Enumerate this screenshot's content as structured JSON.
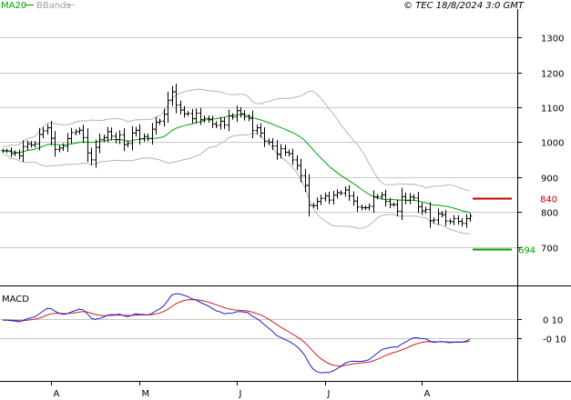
{
  "header": {
    "legend_ma": "MA20",
    "legend_bb": "BBands",
    "copyright": "© TEC 18/8/2024 3:0 GMT"
  },
  "colors": {
    "background": "#ffffff",
    "grid": "#c8c8c8",
    "axis": "#000000",
    "price_bar": "#000000",
    "ma20": "#00a000",
    "bbands": "#b4b4b4",
    "macd_line": "#2020c8",
    "signal_line": "#c82020",
    "resistance": "#c00000",
    "support": "#00a000",
    "legend_bb_text": "#a0a0a0"
  },
  "chart_data": [
    {
      "type": "ohlc",
      "panel": "price",
      "y_ticks": [
        1300,
        1200,
        1100,
        1000,
        900,
        800,
        700
      ],
      "y_tick_labels": [
        "1300",
        "1200",
        "1100",
        "1000",
        "900",
        "800",
        "700"
      ],
      "ylim": [
        592,
        1355
      ],
      "grid": true,
      "x_ticks": [
        {
          "index": 12,
          "label": "A"
        },
        {
          "index": 34,
          "label": "M"
        },
        {
          "index": 58,
          "label": "J"
        },
        {
          "index": 80,
          "label": "J"
        },
        {
          "index": 104,
          "label": "A"
        }
      ],
      "x_count": 117,
      "closes": [
        975,
        975,
        967,
        969,
        961,
        987,
        995,
        992,
        995,
        1022,
        1032,
        1041,
        1011,
        979,
        983,
        988,
        1010,
        1027,
        1030,
        1034,
        1013,
        969,
        949,
        985,
        1008,
        1013,
        1030,
        1017,
        1007,
        1021,
        993,
        996,
        1026,
        1034,
        1010,
        1016,
        1011,
        1037,
        1057,
        1060,
        1080,
        1120,
        1144,
        1106,
        1092,
        1081,
        1082,
        1067,
        1083,
        1064,
        1068,
        1064,
        1052,
        1048,
        1060,
        1049,
        1075,
        1072,
        1090,
        1081,
        1072,
        1068,
        1033,
        1041,
        1026,
        1003,
        1000,
        989,
        966,
        981,
        971,
        967,
        949,
        933,
        904,
        876,
        819,
        818,
        830,
        839,
        846,
        834,
        848,
        855,
        854,
        863,
        846,
        831,
        814,
        812,
        812,
        816,
        843,
        844,
        849,
        830,
        821,
        821,
        802,
        844,
        833,
        843,
        840,
        815,
        803,
        807,
        775,
        777,
        795,
        792,
        774,
        772,
        781,
        773,
        767,
        781,
        788
      ],
      "resistance": {
        "value": 840,
        "label": "840"
      },
      "support": {
        "value": 694,
        "label": "694"
      },
      "legend": [
        "MA20",
        "BBands"
      ],
      "legend_position": "top-left"
    },
    {
      "type": "line",
      "panel": "macd",
      "title": "MACD",
      "y_ticks": [
        10,
        -10
      ],
      "y_tick_labels": [
        "0 10",
        "-0 10"
      ],
      "series": [
        {
          "name": "MACD",
          "role": "macd"
        },
        {
          "name": "",
          "role": "signal"
        }
      ]
    }
  ]
}
